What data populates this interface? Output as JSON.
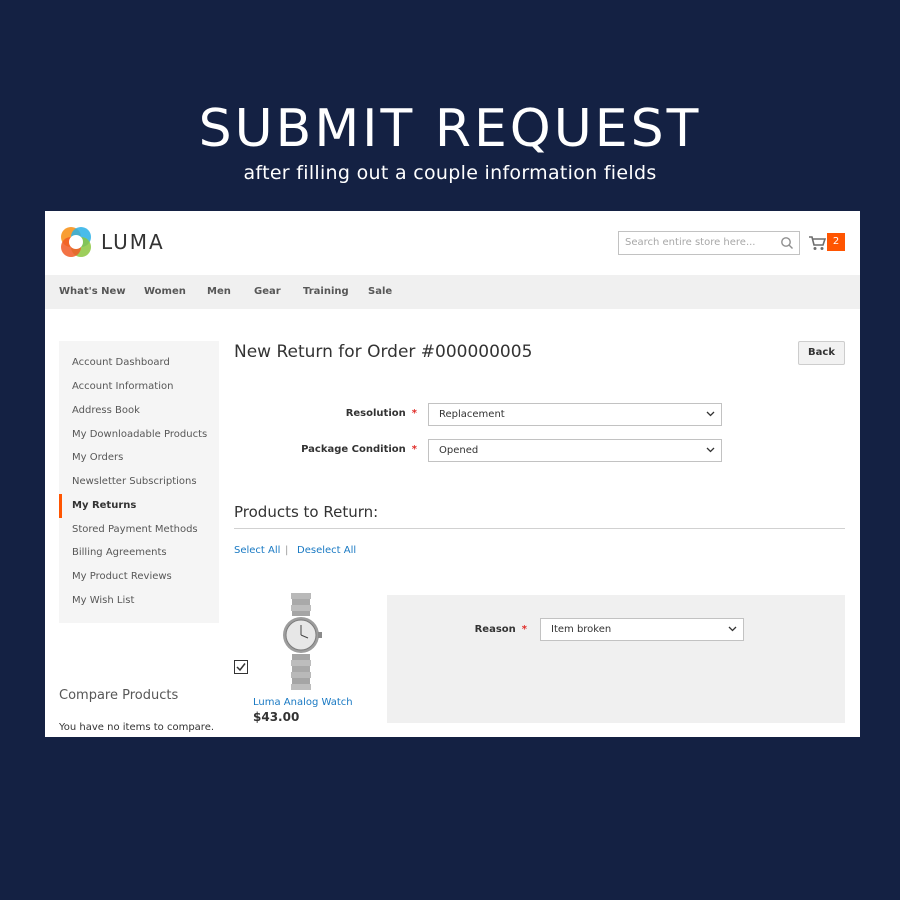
{
  "hero": {
    "title": "SUBMIT REQUEST",
    "subtitle": "after filling out a couple information fields"
  },
  "header": {
    "logo_text": "LUMA",
    "search_placeholder": "Search entire store here...",
    "cart_count": "2"
  },
  "nav": {
    "items": [
      "What's New",
      "Women",
      "Men",
      "Gear",
      "Training",
      "Sale"
    ]
  },
  "sidebar": {
    "items": [
      "Account Dashboard",
      "Account Information",
      "Address Book",
      "My Downloadable Products",
      "My Orders",
      "Newsletter Subscriptions",
      "My Returns",
      "Stored Payment Methods",
      "Billing Agreements",
      "My Product Reviews",
      "My Wish List"
    ],
    "active": "My Returns"
  },
  "compare": {
    "title": "Compare Products",
    "text": "You have no items to compare."
  },
  "main": {
    "title": "New Return for Order #000000005",
    "back_label": "Back",
    "resolution_label": "Resolution",
    "resolution_value": "Replacement",
    "condition_label": "Package Condition",
    "condition_value": "Opened",
    "required_mark": "*",
    "products_title": "Products to Return:",
    "select_all": "Select All",
    "separator": "|",
    "deselect_all": "Deselect All"
  },
  "product": {
    "name": "Luma Analog Watch",
    "price": "$43.00",
    "checked": true,
    "reason_label": "Reason",
    "reason_value": "Item broken"
  },
  "colors": {
    "background": "#142143",
    "accent": "#ff5501",
    "link": "#1979c3",
    "required": "#e02b27"
  }
}
